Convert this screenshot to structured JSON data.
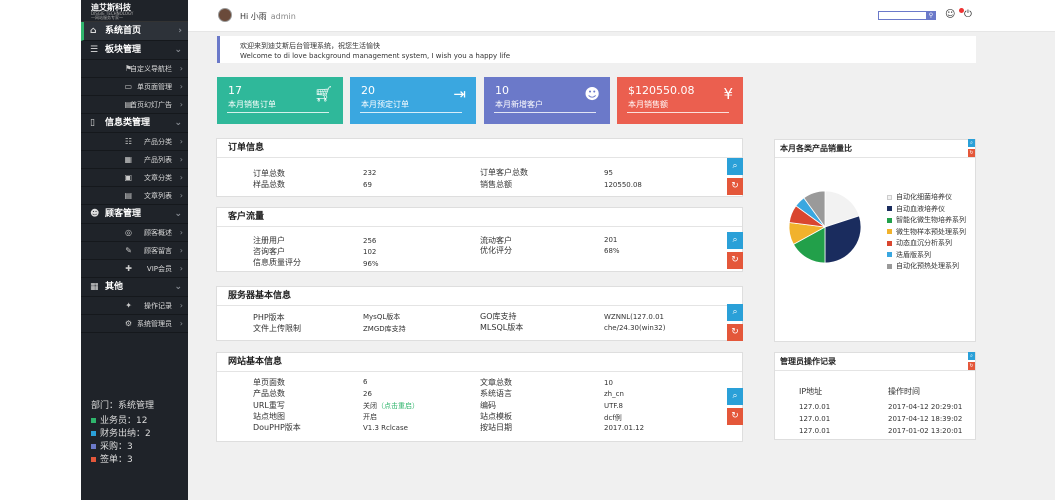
{
  "brand": {
    "name": "迪艾斯科技",
    "sub1": "DISGIE TECHNOLOGY",
    "sub2": "一网站服务专家一"
  },
  "sidebar": {
    "sections": [
      {
        "label": "系统首页",
        "icon": "home-icon"
      },
      {
        "label": "板块管理",
        "icon": "bars-icon"
      },
      {
        "label": "信息类管理",
        "icon": "book-icon"
      },
      {
        "label": "顾客管理",
        "icon": "users-icon"
      },
      {
        "label": "其他",
        "icon": "grid-icon"
      }
    ],
    "subs": {
      "board": [
        {
          "label": "自定义导航栏",
          "icon": "flag-icon"
        },
        {
          "label": "单页面管理",
          "icon": "monitor-icon"
        },
        {
          "label": "首页幻灯广告",
          "icon": "doc-icon"
        }
      ],
      "info": [
        {
          "label": "产品分类",
          "icon": "list-icon"
        },
        {
          "label": "产品列表",
          "icon": "grid-icon"
        },
        {
          "label": "文章分类",
          "icon": "article-icon"
        },
        {
          "label": "文章列表",
          "icon": "article-list-icon"
        }
      ],
      "customer": [
        {
          "label": "顾客概述",
          "icon": "ring-icon"
        },
        {
          "label": "顾客留言",
          "icon": "speech-icon"
        },
        {
          "label": "VIP会员",
          "icon": "tag-icon"
        }
      ],
      "other": [
        {
          "label": "操作记录",
          "icon": "pin-icon"
        },
        {
          "label": "系统管理员",
          "icon": "gear-icon"
        }
      ]
    }
  },
  "department": {
    "title": "部门：系统管理",
    "rows": [
      {
        "label": "业务员：12",
        "color": "#2fb56c"
      },
      {
        "label": "财务出纳：2",
        "color": "#2aa0d8"
      },
      {
        "label": "采购：3",
        "color": "#6b79c9"
      },
      {
        "label": "签单：3",
        "color": "#e4573a"
      }
    ]
  },
  "topbar": {
    "greeting": "Hi 小雨",
    "role": "admin",
    "search_placeholder": ""
  },
  "welcome": {
    "line1": "欢迎来到迪艾斯后台管理系统，祝您生活愉快",
    "line2": "Welcome to di love background management system, I wish you a happy life"
  },
  "stats": [
    {
      "num": "17",
      "label": "本月销售订单",
      "color": "#2fb89a",
      "icon": "cart-icon"
    },
    {
      "num": "20",
      "label": "本月预定订单",
      "color": "#3aa7e0",
      "icon": "exit-icon"
    },
    {
      "num": "10",
      "label": "本月新增客户",
      "color": "#6b79c9",
      "icon": "users-icon"
    },
    {
      "num": "$120550.08",
      "label": "本月销售额",
      "color": "#eb5f4f",
      "icon": "yen-icon"
    }
  ],
  "orders": {
    "title": "订单信息",
    "rows": [
      [
        "订单总数",
        "232",
        "订单客户总数",
        "95"
      ],
      [
        "样品总数",
        "69",
        "销售总额",
        "120550.08"
      ]
    ]
  },
  "traffic": {
    "title": "客户流量",
    "rows": [
      [
        "注册用户",
        "256",
        "流动客户",
        "201"
      ],
      [
        "咨询客户",
        "102",
        "优化评分",
        "68%"
      ],
      [
        "信息质量评分",
        "96%",
        "",
        ""
      ]
    ]
  },
  "server": {
    "title": "服务器基本信息",
    "rows": [
      [
        "PHP版本",
        "MysQL版本",
        "GO库支持",
        "WZNNL(127.0.01"
      ],
      [
        "文件上传限制",
        "ZMGD库支持",
        "MLSQL版本",
        "che/24.30(win32)"
      ]
    ]
  },
  "site": {
    "title": "网站基本信息",
    "rows": [
      [
        "单页面数",
        "6",
        "文章总数",
        "10"
      ],
      [
        "产品总数",
        "26",
        "系统语言",
        "zh_cn"
      ],
      [
        "URL重写",
        "关闭",
        "编码",
        "UTF.8"
      ],
      [
        "站点地图",
        "开启",
        "站点模板",
        "dcf例"
      ],
      [
        "DouPHP版本",
        "V1.3 Rclcase",
        "按站日期",
        "2017.01.12"
      ]
    ],
    "url_link": "（点击重启）"
  },
  "chart_panel": {
    "title": "本月各类产品销量比"
  },
  "chart_data": {
    "type": "pie",
    "title": "本月各类产品销量比",
    "slices": [
      {
        "name": "自动化细菌培养仪",
        "value": 20,
        "color": "#f2f2f2"
      },
      {
        "name": "自动血液培养仪",
        "value": 30,
        "color": "#1a2c5e"
      },
      {
        "name": "智能化微生物培养系列",
        "value": 17,
        "color": "#22a04a"
      },
      {
        "name": "微生物样本预处理系列",
        "value": 10,
        "color": "#f1b22c"
      },
      {
        "name": "动态血沉分析系列",
        "value": 8,
        "color": "#d9462f"
      },
      {
        "name": "迭盾版系列",
        "value": 5,
        "color": "#3aa7e0"
      },
      {
        "name": "自动化预热处理系列",
        "value": 10,
        "color": "#9a9a9a"
      }
    ]
  },
  "log_panel": {
    "title": "管理员操作记录",
    "headers": [
      "IP地址",
      "操作时间"
    ],
    "rows": [
      [
        "127.0.01",
        "2017-04-12  20:29:01"
      ],
      [
        "127.0.01",
        "2017-04-12  18:39:02"
      ],
      [
        "127.0.01",
        "2017-01-02  13:20:01"
      ]
    ]
  }
}
